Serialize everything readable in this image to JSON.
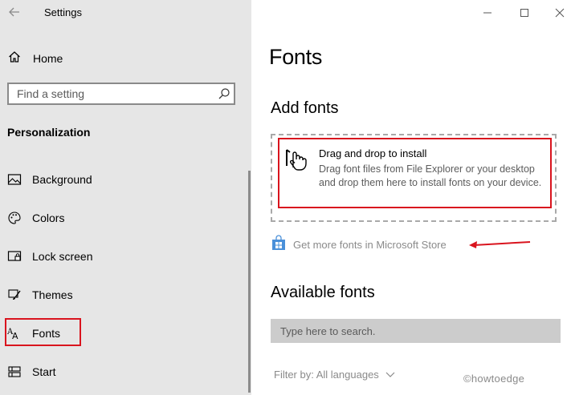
{
  "window": {
    "title": "Settings"
  },
  "sidebar": {
    "home_label": "Home",
    "search_placeholder": "Find a setting",
    "section_title": "Personalization",
    "items": [
      {
        "label": "Background",
        "icon": "picture-icon"
      },
      {
        "label": "Colors",
        "icon": "palette-icon"
      },
      {
        "label": "Lock screen",
        "icon": "lock-screen-icon"
      },
      {
        "label": "Themes",
        "icon": "brush-icon"
      },
      {
        "label": "Fonts",
        "icon": "fonts-icon",
        "selected": true
      },
      {
        "label": "Start",
        "icon": "start-icon"
      }
    ]
  },
  "main": {
    "title": "Fonts",
    "add_fonts_heading": "Add fonts",
    "drop_title": "Drag and drop to install",
    "drop_description": "Drag font files from File Explorer or your desktop and drop them here to install fonts on your device.",
    "store_link": "Get more fonts in Microsoft Store",
    "available_heading": "Available fonts",
    "fonts_search_placeholder": "Type here to search.",
    "filter_label": "Filter by: All languages",
    "watermark": "©howtoedge"
  },
  "colors": {
    "sidebar_bg": "#e6e6e6",
    "highlight": "#d9141e",
    "store_blue": "#4a90d9"
  }
}
